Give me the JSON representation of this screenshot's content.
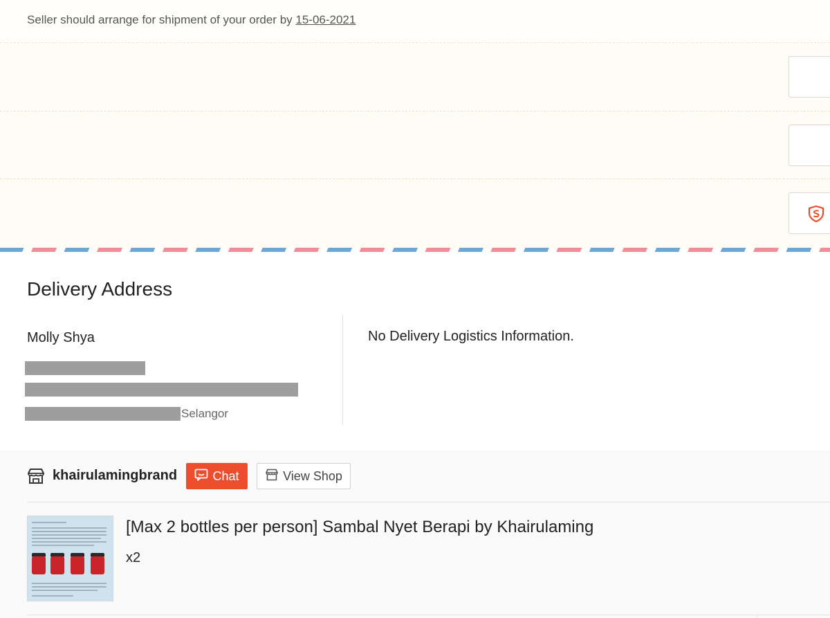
{
  "notice": {
    "text": "Seller should arrange for shipment of your order by ",
    "date": "15-06-2021"
  },
  "address": {
    "title": "Delivery Address",
    "name": "Molly Shya",
    "state": "Selangor",
    "logistics_message": "No Delivery Logistics Information."
  },
  "shop": {
    "name": "khairulamingbrand",
    "chat_label": "Chat",
    "view_shop_label": "View Shop"
  },
  "product": {
    "title": "[Max 2 bottles per person] Sambal Nyet Berapi by Khairulaming",
    "quantity": "x2"
  },
  "colors": {
    "accent": "#ee4d2d",
    "stripe_blue": "#6fa6d6",
    "stripe_red": "#f18d96",
    "notice_bg": "#fffcf5"
  }
}
